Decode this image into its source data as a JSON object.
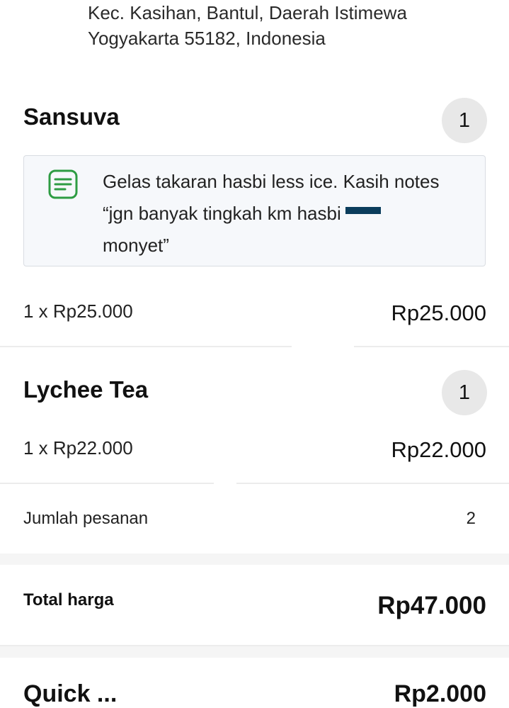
{
  "address": {
    "line1": "Kec. Kasihan, Bantul, Daerah Istimewa",
    "line2": "Yogyakarta 55182, Indonesia"
  },
  "items": [
    {
      "name": "Sansuva",
      "quantity": "1",
      "note": "Gelas takaran hasbi less ice. Kasih notes “jgn banyak tingkah km hasbi",
      "note_end": "monyet”",
      "unit_price": "1 x Rp25.000",
      "total_price": "Rp25.000"
    },
    {
      "name": "Lychee Tea",
      "quantity": "1",
      "unit_price": "1 x Rp22.000",
      "total_price": "Rp22.000"
    }
  ],
  "summary": {
    "order_count_label": "Jumlah pesanan",
    "order_count_value": "2"
  },
  "total": {
    "label": "Total harga",
    "value": "Rp47.000"
  },
  "next_section": {
    "label_partial": "Quick ...",
    "value_partial": "Rp2.000"
  },
  "colors": {
    "note_icon": "#2e9c43",
    "badge_bg": "#e8e8e8",
    "note_bg": "#f6f8fb",
    "redaction": "#0b3d5c"
  }
}
